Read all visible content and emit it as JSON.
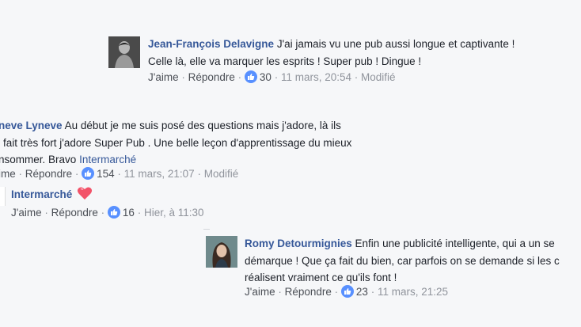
{
  "comments": [
    {
      "author": "Jean-François Delavigne",
      "text_line1": "J'ai jamais vu une pub aussi longue et captivante !",
      "text_line2": "Celle là, elle va marquer les esprits ! Super pub ! Dingue !",
      "like": "J'aime",
      "reply": "Répondre",
      "reactions": "30",
      "time": "11 mars, 20:54",
      "edited": "Modifié"
    },
    {
      "author": "neve Lyneve",
      "text_line1": "Au début je me suis posé des questions mais j'adore, là ils",
      "text_line2": "fait très fort j'adore Super Pub . Une belle leçon d'apprentissage du mieux",
      "text_line3_prefix": "nsommer. Bravo",
      "mention": "Intermarché",
      "like": "ime",
      "reply": "Répondre",
      "reactions": "154",
      "time": "11 mars, 21:07",
      "edited": "Modifié"
    },
    {
      "author": "Intermarché",
      "like": "J'aime",
      "reply": "Répondre",
      "reactions": "16",
      "time": "Hier, à 11:30"
    },
    {
      "author": "Romy Detourmignies",
      "text_line1": "Enfin une publicité intelligente, qui a un se",
      "text_line2": "démarque ! Que ça fait du bien, car parfois on se demande si les c",
      "text_line3": "réalisent vraiment ce qu'ils font !",
      "like": "J'aime",
      "reply": "Répondre",
      "reactions": "23",
      "time": "11 mars, 21:25"
    }
  ],
  "icons": {
    "like": "thumbs-up-icon",
    "heart": "heart-icon"
  },
  "colors": {
    "link": "#365899",
    "meta": "#90949c",
    "like_badge": "#5890ff",
    "heart": "#f25268"
  }
}
